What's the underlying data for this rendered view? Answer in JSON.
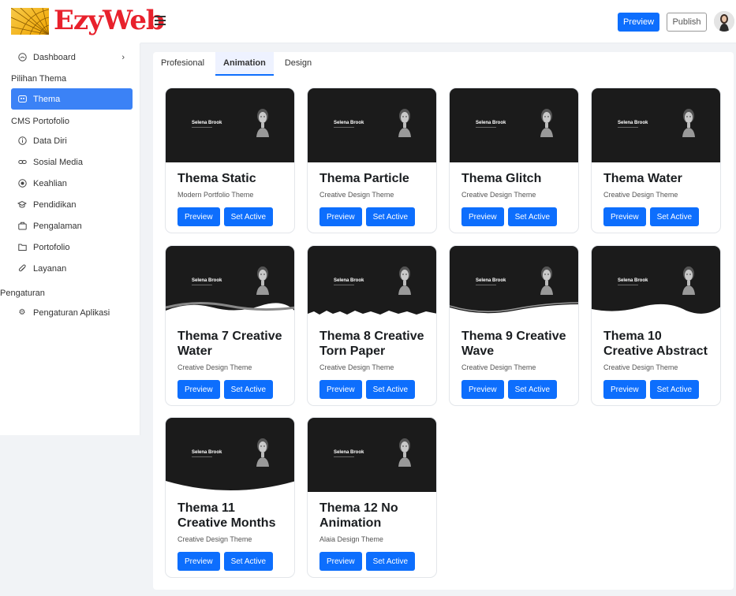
{
  "header": {
    "logo_text": "EzyWeb",
    "preview_label": "Preview",
    "publish_label": "Publish"
  },
  "sidebar": {
    "dashboard": "Dashboard",
    "section_thema": "Pilihan Thema",
    "thema": "Thema",
    "section_cms": "CMS Portofolio",
    "items": [
      {
        "label": "Data Diri",
        "icon": "info-icon"
      },
      {
        "label": "Sosial Media",
        "icon": "link-icon"
      },
      {
        "label": "Keahlian",
        "icon": "target-icon"
      },
      {
        "label": "Pendidikan",
        "icon": "graduation-cap-icon"
      },
      {
        "label": "Pengalaman",
        "icon": "briefcase-icon"
      },
      {
        "label": "Portofolio",
        "icon": "folder-icon"
      },
      {
        "label": "Layanan",
        "icon": "paperclip-icon"
      }
    ],
    "section_settings": "Pengaturan",
    "settings_item": "Pengaturan Aplikasi"
  },
  "tabs": [
    "Profesional",
    "Animation",
    "Design"
  ],
  "active_tab": "Animation",
  "preview_name": "Selena Brook",
  "cards": [
    {
      "title": "Thema Static",
      "desc": "Modern Portfolio Theme",
      "preview": "Preview",
      "set_active": "Set Active"
    },
    {
      "title": "Thema Particle",
      "desc": "Creative Design Theme",
      "preview": "Preview",
      "set_active": "Set Active"
    },
    {
      "title": "Thema Glitch",
      "desc": "Creative Design Theme",
      "preview": "Preview",
      "set_active": "Set Active"
    },
    {
      "title": "Thema Water",
      "desc": "Creative Design Theme",
      "preview": "Preview",
      "set_active": "Set Active"
    },
    {
      "title": "Thema 7 Creative Water",
      "desc": "Creative Design Theme",
      "preview": "Preview",
      "set_active": "Set Active"
    },
    {
      "title": "Thema 8 Creative Torn Paper",
      "desc": "Creative Design Theme",
      "preview": "Preview",
      "set_active": "Set Active"
    },
    {
      "title": "Thema 9 Creative Wave",
      "desc": "Creative Design Theme",
      "preview": "Preview",
      "set_active": "Set Active"
    },
    {
      "title": "Thema 10 Creative Abstract",
      "desc": "Creative Design Theme",
      "preview": "Preview",
      "set_active": "Set Active"
    },
    {
      "title": "Thema 11 Creative Months",
      "desc": "Creative Design Theme",
      "preview": "Preview",
      "set_active": "Set Active"
    },
    {
      "title": "Thema 12 No Animation",
      "desc": "Alaia Design Theme",
      "preview": "Preview",
      "set_active": "Set Active"
    }
  ],
  "colors": {
    "primary": "#0d6efd",
    "sidebar_active": "#3b82f6",
    "logo_red": "#e8212c",
    "thumb_bg": "#1b1b1b"
  }
}
